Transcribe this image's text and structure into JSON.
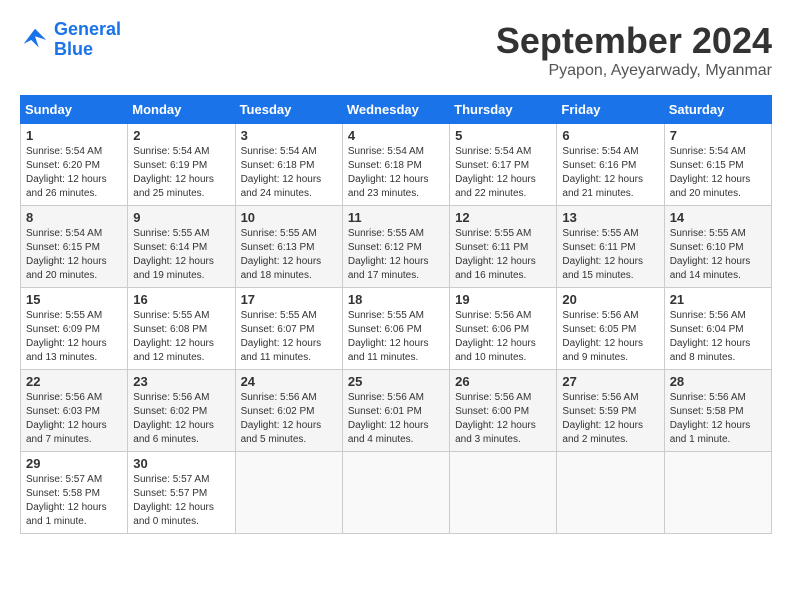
{
  "header": {
    "logo_line1": "General",
    "logo_line2": "Blue",
    "title": "September 2024",
    "location": "Pyapon, Ayeyarwady, Myanmar"
  },
  "days_of_week": [
    "Sunday",
    "Monday",
    "Tuesday",
    "Wednesday",
    "Thursday",
    "Friday",
    "Saturday"
  ],
  "weeks": [
    [
      {
        "day": "1",
        "sunrise": "5:54 AM",
        "sunset": "6:20 PM",
        "daylight": "12 hours and 26 minutes."
      },
      {
        "day": "2",
        "sunrise": "5:54 AM",
        "sunset": "6:19 PM",
        "daylight": "12 hours and 25 minutes."
      },
      {
        "day": "3",
        "sunrise": "5:54 AM",
        "sunset": "6:18 PM",
        "daylight": "12 hours and 24 minutes."
      },
      {
        "day": "4",
        "sunrise": "5:54 AM",
        "sunset": "6:18 PM",
        "daylight": "12 hours and 23 minutes."
      },
      {
        "day": "5",
        "sunrise": "5:54 AM",
        "sunset": "6:17 PM",
        "daylight": "12 hours and 22 minutes."
      },
      {
        "day": "6",
        "sunrise": "5:54 AM",
        "sunset": "6:16 PM",
        "daylight": "12 hours and 21 minutes."
      },
      {
        "day": "7",
        "sunrise": "5:54 AM",
        "sunset": "6:15 PM",
        "daylight": "12 hours and 20 minutes."
      }
    ],
    [
      {
        "day": "8",
        "sunrise": "5:54 AM",
        "sunset": "6:15 PM",
        "daylight": "12 hours and 20 minutes."
      },
      {
        "day": "9",
        "sunrise": "5:55 AM",
        "sunset": "6:14 PM",
        "daylight": "12 hours and 19 minutes."
      },
      {
        "day": "10",
        "sunrise": "5:55 AM",
        "sunset": "6:13 PM",
        "daylight": "12 hours and 18 minutes."
      },
      {
        "day": "11",
        "sunrise": "5:55 AM",
        "sunset": "6:12 PM",
        "daylight": "12 hours and 17 minutes."
      },
      {
        "day": "12",
        "sunrise": "5:55 AM",
        "sunset": "6:11 PM",
        "daylight": "12 hours and 16 minutes."
      },
      {
        "day": "13",
        "sunrise": "5:55 AM",
        "sunset": "6:11 PM",
        "daylight": "12 hours and 15 minutes."
      },
      {
        "day": "14",
        "sunrise": "5:55 AM",
        "sunset": "6:10 PM",
        "daylight": "12 hours and 14 minutes."
      }
    ],
    [
      {
        "day": "15",
        "sunrise": "5:55 AM",
        "sunset": "6:09 PM",
        "daylight": "12 hours and 13 minutes."
      },
      {
        "day": "16",
        "sunrise": "5:55 AM",
        "sunset": "6:08 PM",
        "daylight": "12 hours and 12 minutes."
      },
      {
        "day": "17",
        "sunrise": "5:55 AM",
        "sunset": "6:07 PM",
        "daylight": "12 hours and 11 minutes."
      },
      {
        "day": "18",
        "sunrise": "5:55 AM",
        "sunset": "6:06 PM",
        "daylight": "12 hours and 11 minutes."
      },
      {
        "day": "19",
        "sunrise": "5:56 AM",
        "sunset": "6:06 PM",
        "daylight": "12 hours and 10 minutes."
      },
      {
        "day": "20",
        "sunrise": "5:56 AM",
        "sunset": "6:05 PM",
        "daylight": "12 hours and 9 minutes."
      },
      {
        "day": "21",
        "sunrise": "5:56 AM",
        "sunset": "6:04 PM",
        "daylight": "12 hours and 8 minutes."
      }
    ],
    [
      {
        "day": "22",
        "sunrise": "5:56 AM",
        "sunset": "6:03 PM",
        "daylight": "12 hours and 7 minutes."
      },
      {
        "day": "23",
        "sunrise": "5:56 AM",
        "sunset": "6:02 PM",
        "daylight": "12 hours and 6 minutes."
      },
      {
        "day": "24",
        "sunrise": "5:56 AM",
        "sunset": "6:02 PM",
        "daylight": "12 hours and 5 minutes."
      },
      {
        "day": "25",
        "sunrise": "5:56 AM",
        "sunset": "6:01 PM",
        "daylight": "12 hours and 4 minutes."
      },
      {
        "day": "26",
        "sunrise": "5:56 AM",
        "sunset": "6:00 PM",
        "daylight": "12 hours and 3 minutes."
      },
      {
        "day": "27",
        "sunrise": "5:56 AM",
        "sunset": "5:59 PM",
        "daylight": "12 hours and 2 minutes."
      },
      {
        "day": "28",
        "sunrise": "5:56 AM",
        "sunset": "5:58 PM",
        "daylight": "12 hours and 1 minute."
      }
    ],
    [
      {
        "day": "29",
        "sunrise": "5:57 AM",
        "sunset": "5:58 PM",
        "daylight": "12 hours and 1 minute."
      },
      {
        "day": "30",
        "sunrise": "5:57 AM",
        "sunset": "5:57 PM",
        "daylight": "12 hours and 0 minutes."
      },
      null,
      null,
      null,
      null,
      null
    ]
  ]
}
